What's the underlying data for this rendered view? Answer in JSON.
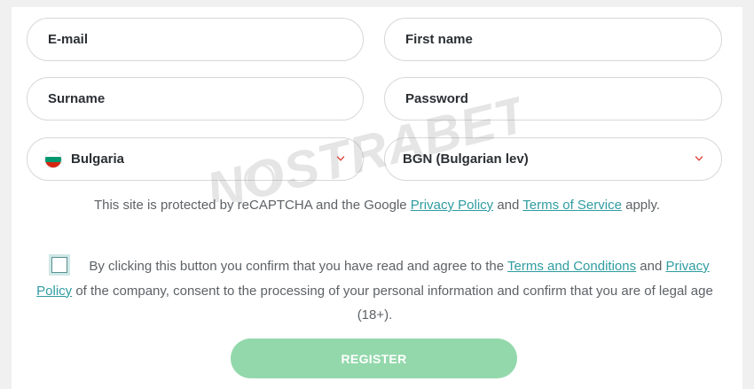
{
  "form": {
    "email_placeholder": "E-mail",
    "first_name_placeholder": "First name",
    "surname_placeholder": "Surname",
    "password_placeholder": "Password",
    "country_value": "Bulgaria",
    "country_flag": "bulgaria-flag-icon",
    "currency_value": "BGN (Bulgarian lev)",
    "chevron_icon": "chevron-down-icon",
    "chevron_color": "#e0453a"
  },
  "recaptcha": {
    "text_before": "This site is protected by reCAPTCHA and the Google ",
    "privacy_link": "Privacy Policy",
    "text_and": " and ",
    "terms_link": "Terms of Service",
    "text_after": " apply."
  },
  "consent": {
    "checked": false,
    "text_before": "By clicking this button you confirm that you have read and agree to the ",
    "terms_link": "Terms and Conditions",
    "text_and": " and ",
    "privacy_link": "Privacy Policy",
    "text_after": " of the company, consent to the processing of your personal information and confirm that you are of legal age (18+)."
  },
  "register_button": {
    "label": "REGISTER",
    "color": "#93d8ab"
  },
  "watermark": {
    "text": "NOSTRABET"
  },
  "colors": {
    "link": "#2f9ca0",
    "text": "#5d6266",
    "field_border": "#d7d7d7"
  }
}
